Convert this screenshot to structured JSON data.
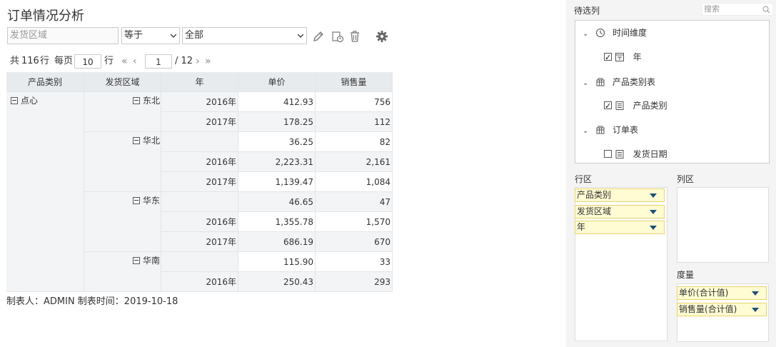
{
  "title": "订单情况分析",
  "filter": {
    "field_placeholder": "发货区域",
    "operator": "等于",
    "value": "全部"
  },
  "toolbar": {
    "icons": [
      "pencil-icon",
      "refresh-filter-icon",
      "trash-icon",
      "settings-gear-icon"
    ]
  },
  "pager": {
    "total_prefix": "共",
    "total_rows": "116",
    "total_suffix": "行",
    "per_page_label": "每页",
    "per_page": "10",
    "per_page_suffix": "行",
    "first": "«",
    "prev": "‹",
    "current_page": "1",
    "total_pages": "/ 12",
    "next": "›",
    "last": "»"
  },
  "table": {
    "columns": [
      "产品类别",
      "发货区域",
      "年",
      "单价",
      "销售量"
    ],
    "category": "点心",
    "regions": [
      "东北",
      "华北",
      "华东",
      "华南"
    ],
    "rows": [
      {
        "year": "2016年",
        "price": "412.93",
        "qty": "756"
      },
      {
        "year": "2017年",
        "price": "178.25",
        "qty": "112"
      },
      {
        "year": "",
        "price": "36.25",
        "qty": "82"
      },
      {
        "year": "2016年",
        "price": "2,223.31",
        "qty": "2,161"
      },
      {
        "year": "2017年",
        "price": "1,139.47",
        "qty": "1,084"
      },
      {
        "year": "",
        "price": "46.65",
        "qty": "47"
      },
      {
        "year": "2016年",
        "price": "1,355.78",
        "qty": "1,570"
      },
      {
        "year": "2017年",
        "price": "686.19",
        "qty": "670"
      },
      {
        "year": "",
        "price": "115.90",
        "qty": "33"
      },
      {
        "year": "2016年",
        "price": "250.43",
        "qty": "293"
      }
    ]
  },
  "footer": "制表人：ADMIN   制表时间：2019-10-18",
  "panel": {
    "title": "待选列",
    "search_placeholder": "搜索",
    "tree": [
      {
        "label": "时间维度",
        "type": "group"
      },
      {
        "label": "年",
        "type": "field",
        "checked": true
      },
      {
        "label": "产品类别表",
        "type": "group"
      },
      {
        "label": "产品类别",
        "type": "field",
        "checked": true
      },
      {
        "label": "订单表",
        "type": "group"
      },
      {
        "label": "发货日期",
        "type": "field",
        "checked": false
      }
    ],
    "row_zone_label": "行区",
    "col_zone_label": "列区",
    "measure_zone_label": "度量",
    "row_fields": [
      "产品类别",
      "发货区域",
      "年"
    ],
    "measures": [
      "单价(合计值)",
      "销售量(合计值)"
    ]
  },
  "colors": {
    "header_bg": "#e8ebee",
    "dim_bg": "#f2f4f6",
    "chip_bg": "#fffbd3",
    "chip_border": "#e9d36a",
    "accent_arrow": "#1f4e79"
  }
}
